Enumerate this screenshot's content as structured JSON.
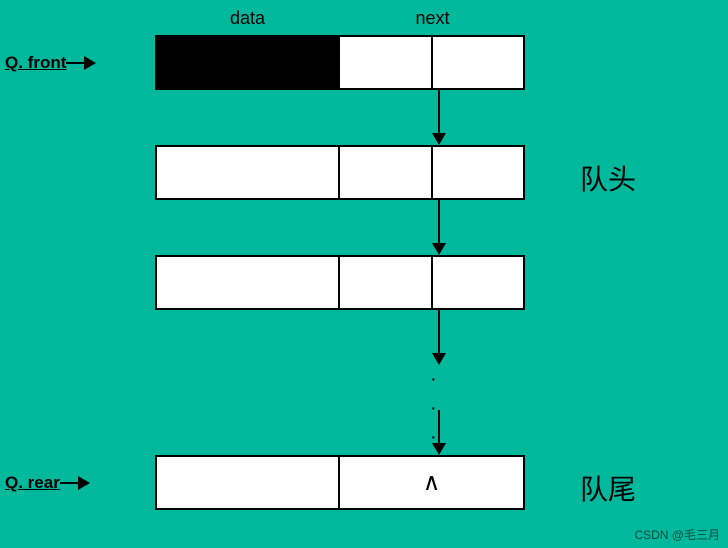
{
  "header": {
    "data_label": "data",
    "next_label": "next"
  },
  "labels": {
    "front": "Q. front",
    "rear": "Q. rear",
    "queue_head": "队头",
    "queue_tail": "队尾"
  },
  "nodes": [
    {
      "id": 1,
      "data_filled": true,
      "is_rear": false
    },
    {
      "id": 2,
      "data_filled": false,
      "is_rear": false
    },
    {
      "id": 3,
      "data_filled": false,
      "is_rear": false
    },
    {
      "id": 4,
      "data_filled": false,
      "is_rear": true
    }
  ],
  "watermark": "CSDN @毛三月"
}
